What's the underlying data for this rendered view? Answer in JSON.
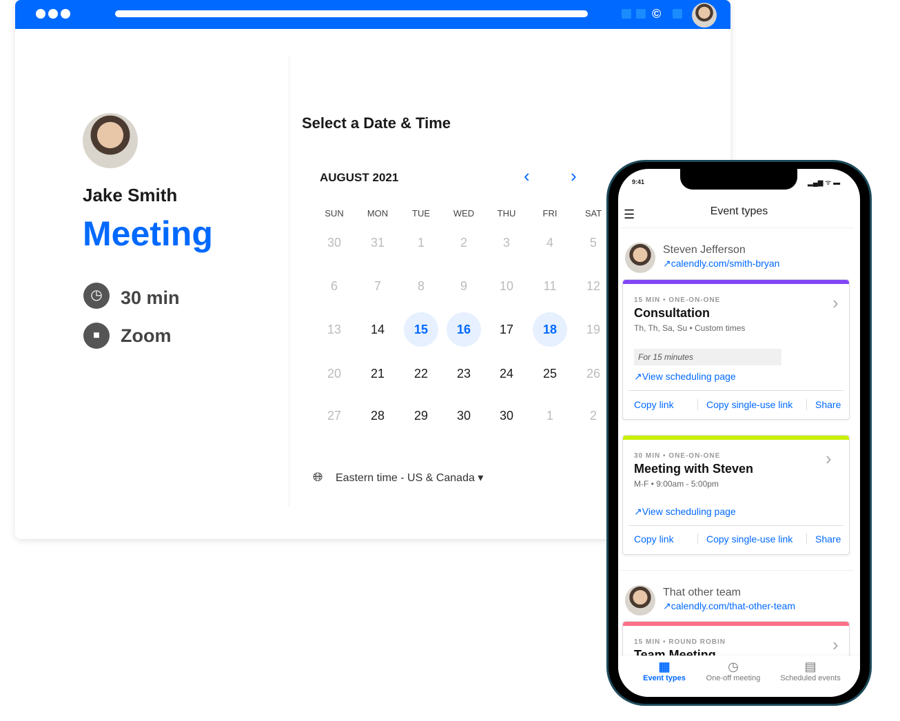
{
  "browser": {
    "accent": "#0069ff"
  },
  "profile": {
    "name": "Jake Smith",
    "event": "Meeting",
    "duration": "30 min",
    "location": "Zoom"
  },
  "calendar": {
    "title": "Select a Date & Time",
    "month": "AUGUST 2021",
    "weekdays": [
      "SUN",
      "MON",
      "TUE",
      "WED",
      "THU",
      "FRI",
      "SAT"
    ],
    "weeks": [
      [
        "30",
        "31",
        "1",
        "2",
        "3",
        "4",
        "5"
      ],
      [
        "6",
        "7",
        "8",
        "9",
        "10",
        "11",
        "12"
      ],
      [
        "13",
        "14",
        "15",
        "16",
        "17",
        "18",
        "19"
      ],
      [
        "20",
        "21",
        "22",
        "23",
        "24",
        "25",
        "26"
      ],
      [
        "27",
        "28",
        "29",
        "30",
        "30",
        "1",
        "2"
      ]
    ],
    "available": [
      "14",
      "15",
      "16",
      "17",
      "18",
      "21",
      "22",
      "23",
      "24",
      "25",
      "28",
      "29",
      "30",
      "30",
      "1"
    ],
    "selected_highlight": [
      "15",
      "16",
      "18"
    ],
    "timezone": "Eastern time - US & Canada"
  },
  "phone": {
    "time": "9:41",
    "title": "Event types",
    "users": [
      {
        "name": "Steven Jefferson",
        "link": "calendly.com/smith-bryan"
      },
      {
        "name": "That other team",
        "link": "calendly.com/that-other-team"
      }
    ],
    "cards": [
      {
        "meta": "15 MIN • ONE-ON-ONE",
        "title": "Consultation",
        "sub": "Th, Th, Sa, Su • Custom times",
        "note": "For 15 minutes",
        "view": "View scheduling page",
        "color": "#8247f5"
      },
      {
        "meta": "30 MIN • ONE-ON-ONE",
        "title": "Meeting with Steven",
        "sub": "M-F • 9:00am - 5:00pm",
        "view": "View scheduling page",
        "color": "#c8f000"
      },
      {
        "meta": "15 MIN • ROUND ROBIN",
        "title": "Team Meeting",
        "color": "#ff6f87"
      }
    ],
    "actions": {
      "copy": "Copy link",
      "single": "Copy single-use link",
      "share": "Share"
    },
    "nav": [
      "Event types",
      "One-off meeting",
      "Scheduled events"
    ]
  }
}
